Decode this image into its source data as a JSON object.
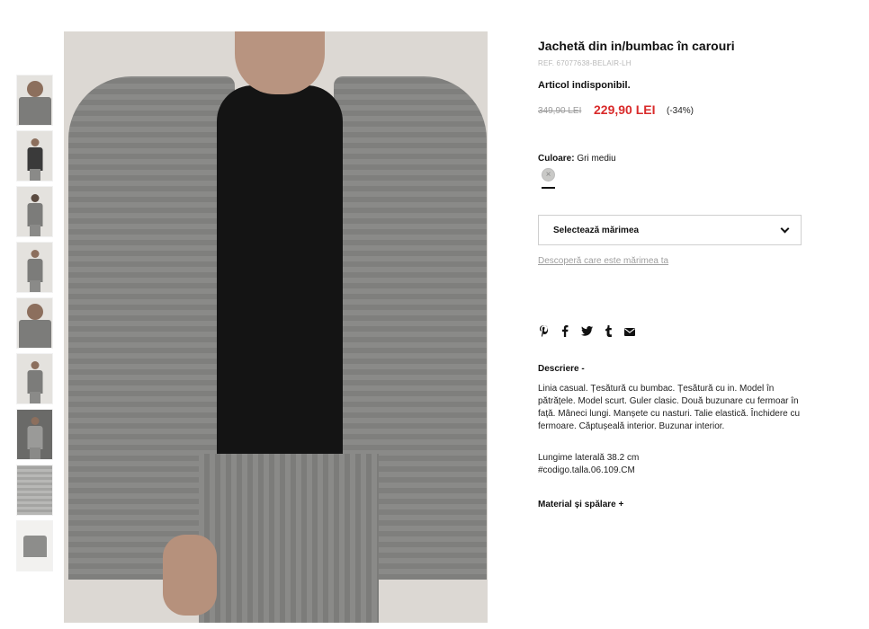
{
  "product": {
    "title": "Jachetă din in/bumbac în carouri",
    "ref": "REF. 67077638-BELAIR-LH",
    "availability": "Articol indisponibil.",
    "old_price": "349,90 LEI",
    "new_price": "229,90 LEI",
    "discount": "(-34%)",
    "price_color": "#d92b2b"
  },
  "color": {
    "label": "Culoare:",
    "value": "Gri mediu",
    "swatch_icon": "×"
  },
  "size": {
    "select_label": "Selectează mărimea",
    "guide_link": "Descoperă care este mărimea ta"
  },
  "social": {
    "icons": [
      "pinterest-icon",
      "facebook-icon",
      "twitter-icon",
      "tumblr-icon",
      "mail-icon"
    ],
    "glyphs": [
      "𝗣",
      "f",
      "🐦",
      "t",
      "✉"
    ]
  },
  "description": {
    "title": "Descriere -",
    "text": "Linia casual. Țesătură cu bumbac. Țesătură cu in. Model în pătrățele. Model scurt. Guler clasic. Două buzunare cu fermoar în față. Mâneci lungi. Manșete cu nasturi. Talie elastică. Închidere cu fermoare. Căptușeală interior. Buzunar interior.",
    "length": "Lungime laterală 38.2 cm",
    "code": "#codigo.talla.06.109.CM"
  },
  "material": {
    "title": "Material și spălare +"
  }
}
